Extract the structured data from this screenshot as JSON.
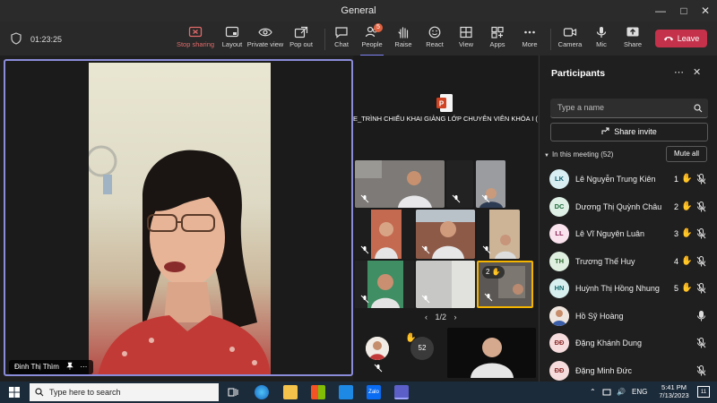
{
  "window": {
    "title": "General"
  },
  "meeting": {
    "timer": "01:23:25"
  },
  "toolbar": {
    "stop_sharing": "Stop sharing",
    "layout": "Layout",
    "private_view": "Private view",
    "pop_out": "Pop out",
    "chat": "Chat",
    "people": "People",
    "people_badge": "5",
    "raise": "Raise",
    "react": "React",
    "view": "View",
    "apps": "Apps",
    "more": "More",
    "camera": "Camera",
    "mic": "Mic",
    "share": "Share",
    "leave": "Leave"
  },
  "stage": {
    "speaker_name": "Đinh Thị Thìm"
  },
  "gallery": {
    "shared_file": "E_TRÌNH CHIẾU KHAI GIẢNG LỚP CHUYÊN VIÊN KHÓA I (1).p",
    "pager": "1/2",
    "raised_hand_tile": "2",
    "overflow_count": "52"
  },
  "participants": {
    "title": "Participants",
    "search_placeholder": "Type a name",
    "share_invite": "Share invite",
    "in_meeting_label": "In this meeting (52)",
    "mute_all": "Mute all",
    "list": [
      {
        "initials": "LK",
        "name": "Lê Nguyễn Trung Kiên",
        "hand": "1",
        "bg": "#d9eef2",
        "fg": "#0d5e6e"
      },
      {
        "initials": "DC",
        "name": "Dương Thị Quỳnh Châu",
        "hand": "2",
        "bg": "#dff1e6",
        "fg": "#1e6b3c"
      },
      {
        "initials": "LL",
        "name": "Lê Vĩ Nguyên Luân",
        "hand": "3",
        "bg": "#fbe3ee",
        "fg": "#8e2a5a"
      },
      {
        "initials": "TH",
        "name": "Trương Thế Huy",
        "hand": "4",
        "bg": "#dff0e0",
        "fg": "#2e6b30"
      },
      {
        "initials": "HN",
        "name": "Huỳnh Thị Hồng Nhung",
        "hand": "5",
        "bg": "#d8eff0",
        "fg": "#11696d"
      },
      {
        "initials": "",
        "name": "Hồ Sỹ Hoàng",
        "hand": "",
        "bg": "#e8b9a9",
        "fg": "#6a3a2a"
      },
      {
        "initials": "ĐĐ",
        "name": "Đặng Khánh Dung",
        "hand": "",
        "bg": "#f6dcdc",
        "fg": "#8e2d2d"
      },
      {
        "initials": "ĐĐ",
        "name": "Đặng Minh Đức",
        "hand": "",
        "bg": "#f6dcdc",
        "fg": "#8e2d2d"
      }
    ]
  },
  "taskbar": {
    "search_placeholder": "Type here to search",
    "language": "ENG",
    "time": "5:41 PM",
    "date": "7/13/2023",
    "notifications": "11"
  },
  "colors": {
    "accent": "#7f85f5",
    "leave": "#c4314b",
    "hand": "#f4b400"
  }
}
